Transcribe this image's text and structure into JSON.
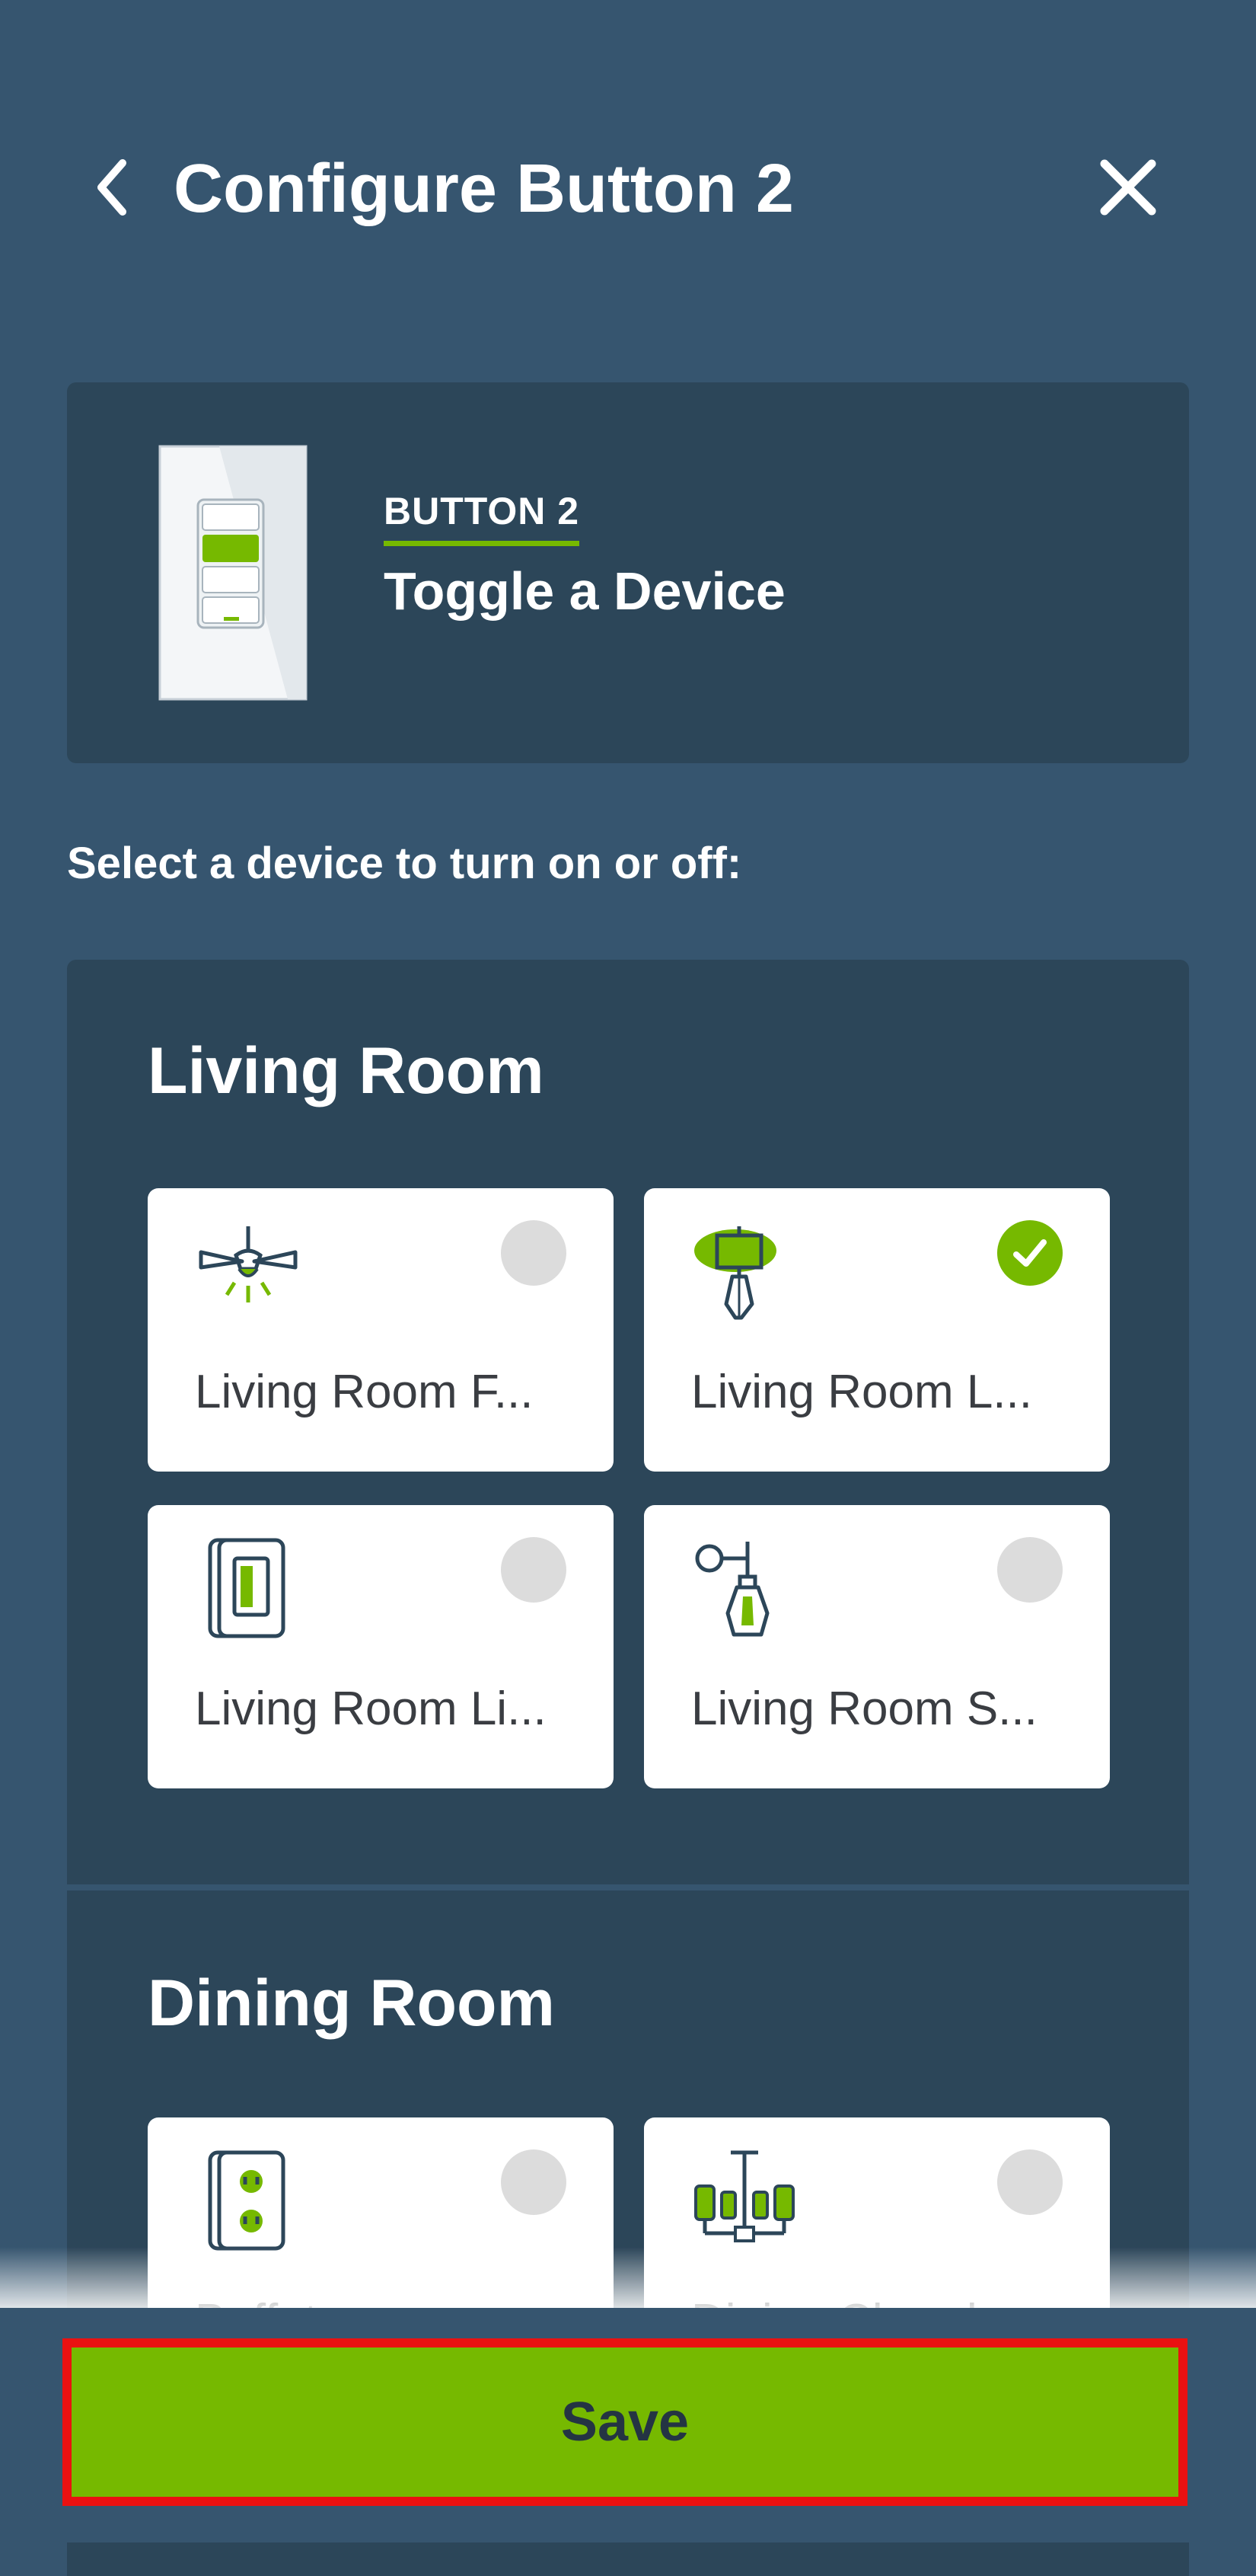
{
  "header": {
    "title": "Configure Button 2",
    "back_icon": "chevron-left-icon",
    "close_icon": "close-icon"
  },
  "summary": {
    "label": "BUTTON 2",
    "action": "Toggle a Device"
  },
  "prompt": "Select a device to turn on or off:",
  "rooms": [
    {
      "name": "Living Room",
      "devices": [
        {
          "name": "Living Room F...",
          "icon": "ceiling-fan-light-icon",
          "selected": false
        },
        {
          "name": "Living Room L...",
          "icon": "table-lamp-icon",
          "selected": true
        },
        {
          "name": "Living Room Li...",
          "icon": "light-switch-icon",
          "selected": false
        },
        {
          "name": "Living Room S...",
          "icon": "wall-sconce-icon",
          "selected": false
        }
      ]
    },
    {
      "name": "Dining Room",
      "devices": [
        {
          "name": "Buffet ...",
          "icon": "outlet-icon",
          "selected": false
        },
        {
          "name": "Dining Chand...",
          "icon": "chandelier-icon",
          "selected": false
        }
      ]
    }
  ],
  "save_label": "Save",
  "colors": {
    "background": "#36556f",
    "card": "#2c4659",
    "accent": "#76b900",
    "highlight_border": "#ea1111"
  }
}
